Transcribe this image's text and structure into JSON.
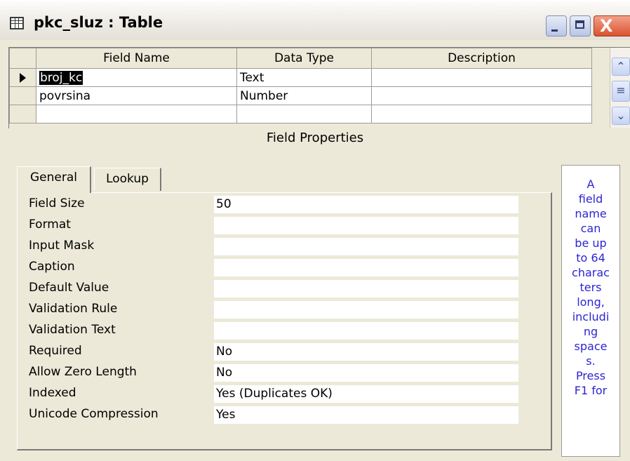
{
  "window": {
    "title": "pkc_sluz : Table",
    "close_glyph": "X"
  },
  "grid": {
    "headers": [
      "Field Name",
      "Data Type",
      "Description"
    ],
    "rows": [
      {
        "name": "broj_kc",
        "type": "Text",
        "description": "",
        "current": true
      },
      {
        "name": "povrsina",
        "type": "Number",
        "description": "",
        "current": false
      },
      {
        "name": "",
        "type": "",
        "description": "",
        "current": false
      }
    ],
    "scroll_up": "⌃",
    "scroll_thumb": "≡",
    "scroll_down": "⌄"
  },
  "field_properties": {
    "header": "Field Properties",
    "tabs": [
      {
        "label": "General",
        "active": true
      },
      {
        "label": "Lookup",
        "active": false
      }
    ],
    "properties": [
      {
        "label": "Field Size",
        "value": "50"
      },
      {
        "label": "Format",
        "value": ""
      },
      {
        "label": "Input Mask",
        "value": ""
      },
      {
        "label": "Caption",
        "value": ""
      },
      {
        "label": "Default Value",
        "value": ""
      },
      {
        "label": "Validation Rule",
        "value": ""
      },
      {
        "label": "Validation Text",
        "value": ""
      },
      {
        "label": "Required",
        "value": "No"
      },
      {
        "label": "Allow Zero Length",
        "value": "No"
      },
      {
        "label": "Indexed",
        "value": "Yes (Duplicates OK)"
      },
      {
        "label": "Unicode Compression",
        "value": "Yes"
      }
    ]
  },
  "help": {
    "lines": [
      "A",
      "field",
      "name",
      "can",
      "be up",
      "to 64",
      "charac",
      "ters",
      "long,",
      "includi",
      "ng",
      "space",
      "s.",
      "Press",
      "F1 for"
    ]
  },
  "colors": {
    "window_bg": "#ece9d8",
    "help_text": "#2d24d4",
    "close_button": "#d9532f",
    "selection": "#000000"
  }
}
